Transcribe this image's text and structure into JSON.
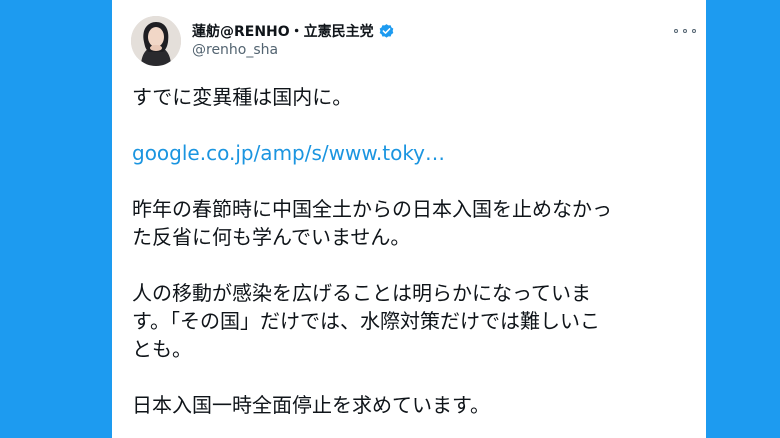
{
  "tweet": {
    "author": {
      "display_name": "蓮舫@RENHO・立憲民主党",
      "handle": "@renho_sha",
      "verified": true,
      "avatar_icon": "profile-photo"
    },
    "more_icon": "more-options-icon",
    "paragraphs": [
      {
        "type": "text",
        "lines": [
          "すでに変異種は国内に。"
        ]
      },
      {
        "type": "link",
        "text": "google.co.jp/amp/s/www.toky…"
      },
      {
        "type": "text",
        "lines": [
          "昨年の春節時に中国全土からの日本入国を止めなかっ",
          "た反省に何も学んでいません。"
        ]
      },
      {
        "type": "text",
        "lines": [
          "人の移動が感染を広げることは明らかになっていま",
          "す。「その国」だけでは、水際対策だけでは難しいこ",
          "とも。"
        ]
      },
      {
        "type": "text",
        "lines": [
          "日本入国一時全面停止を求めています。"
        ]
      }
    ]
  },
  "colors": {
    "background": "#1d9bf0",
    "card": "#ffffff",
    "link": "#1b95e0",
    "verified_badge": "#1d9bf0",
    "text": "#0f1419",
    "secondary_text": "#536471"
  }
}
